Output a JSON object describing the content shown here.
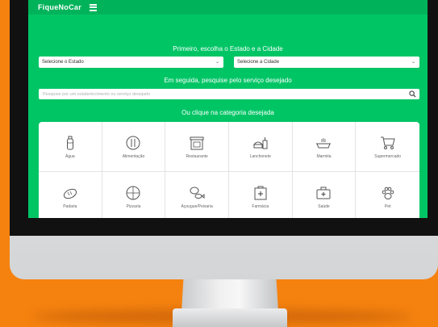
{
  "app": {
    "logo": "FiqueNoCar",
    "menu_icon": "menu-icon"
  },
  "colors": {
    "brand_green": "#00c565",
    "background_orange": "#f5820f"
  },
  "step1_label": "Primeiro, escolha o Estado e a Cidade",
  "state_select": {
    "value": "Selecione o Estado"
  },
  "city_select": {
    "value": "Selecione a Cidade"
  },
  "step2_label": "Em seguida, pesquise pelo serviço desejado",
  "search": {
    "placeholder": "Pesquise por um estabelecimento ou serviço desejado"
  },
  "step3_label": "Ou clique na categoria desejada",
  "categories": [
    {
      "label": "Água",
      "icon": "water-bottle-icon"
    },
    {
      "label": "Alimentação",
      "icon": "plate-cutlery-icon"
    },
    {
      "label": "Restaurante",
      "icon": "restaurant-icon"
    },
    {
      "label": "Lanchonete",
      "icon": "burger-drink-icon"
    },
    {
      "label": "Marmita",
      "icon": "lunchbox-icon"
    },
    {
      "label": "Supermercado",
      "icon": "shopping-cart-icon"
    },
    {
      "label": "Padaria",
      "icon": "bread-icon"
    },
    {
      "label": "Pizzaria",
      "icon": "pizza-icon"
    },
    {
      "label": "Açougue/Peixaria",
      "icon": "meat-fish-icon"
    },
    {
      "label": "Farmácia",
      "icon": "pharmacy-icon"
    },
    {
      "label": "Saúde",
      "icon": "medical-kit-icon"
    },
    {
      "label": "Pet",
      "icon": "paw-icon"
    }
  ]
}
